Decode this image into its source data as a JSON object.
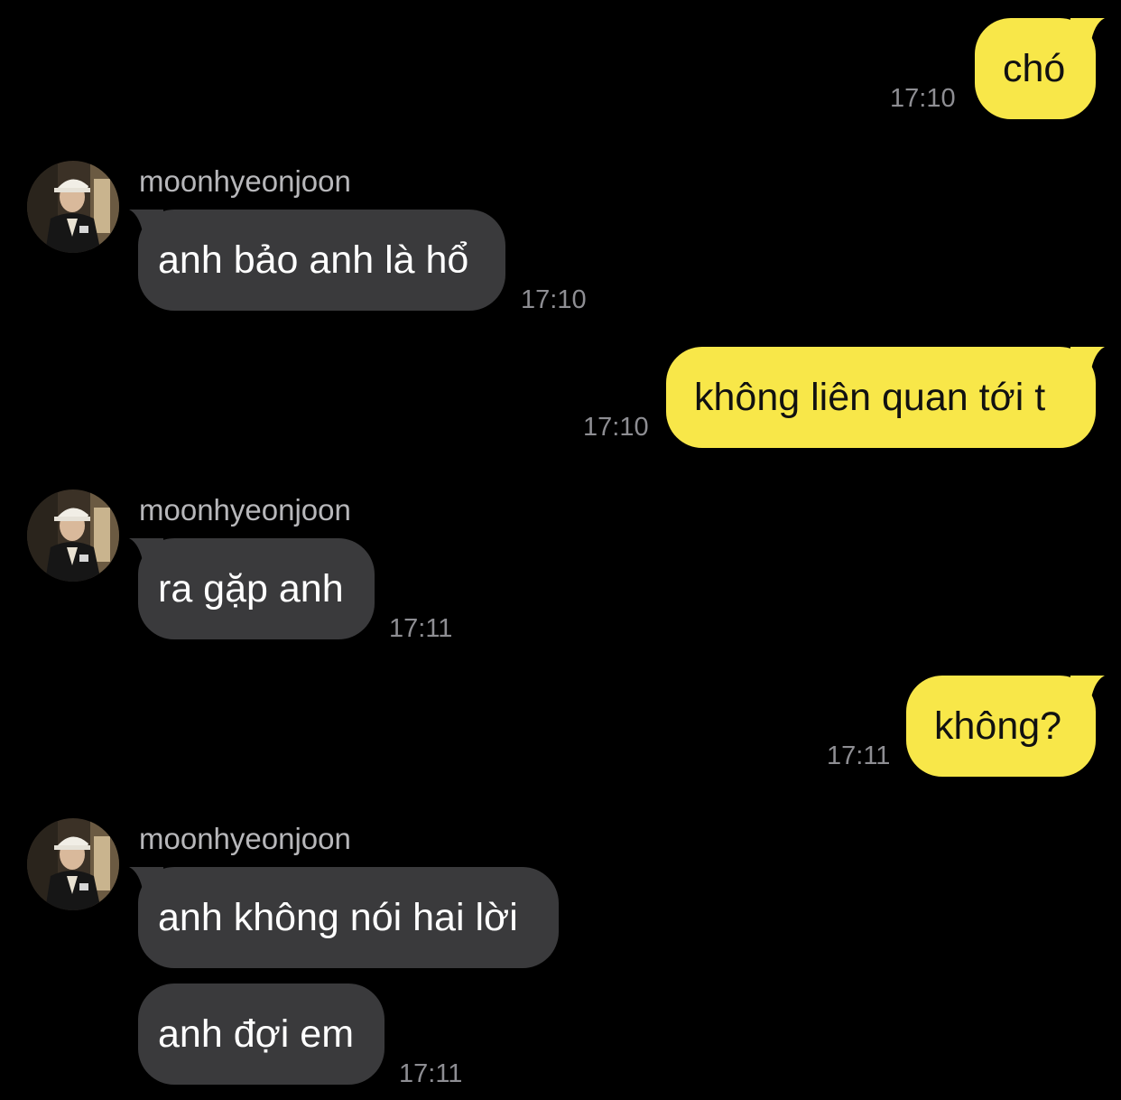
{
  "messages": {
    "out1": {
      "text": "chó",
      "time": "17:10"
    },
    "in1": {
      "sender": "moonhyeonjoon",
      "text": "anh bảo anh là hổ",
      "time": "17:10"
    },
    "out2": {
      "text": "không liên quan tới t",
      "time": "17:10"
    },
    "in2": {
      "sender": "moonhyeonjoon",
      "text": "ra gặp anh",
      "time": "17:11"
    },
    "out3": {
      "text": "không?",
      "time": "17:11"
    },
    "in3": {
      "sender": "moonhyeonjoon",
      "text": "anh không nói hai lời",
      "text2": "anh đợi em",
      "time": "17:11"
    }
  },
  "colors": {
    "background": "#000000",
    "outgoing_bubble": "#F8E749",
    "incoming_bubble": "#3A3A3C",
    "timestamp": "#8E8E93",
    "sender_name": "#B7B7BA"
  },
  "icons": {
    "avatar": "avatar-photo"
  }
}
